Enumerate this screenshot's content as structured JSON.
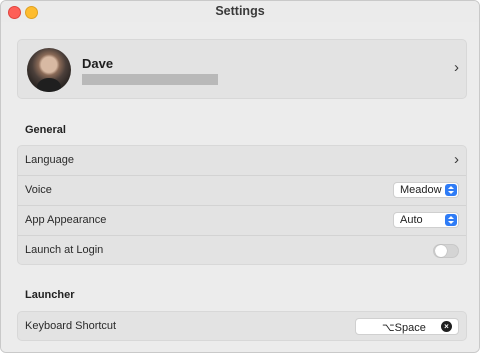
{
  "window": {
    "title": "Settings"
  },
  "profile": {
    "name": "Dave",
    "chevron": "›"
  },
  "sections": {
    "general": {
      "title": "General",
      "language_label": "Language",
      "language_chevron": "›",
      "voice_label": "Voice",
      "voice_value": "Meadow",
      "appearance_label": "App Appearance",
      "appearance_value": "Auto",
      "launch_label": "Launch at Login",
      "launch_enabled": false
    },
    "launcher": {
      "title": "Launcher",
      "shortcut_label": "Keyboard Shortcut",
      "shortcut_value": "⌥Space",
      "clear_symbol": "×"
    }
  },
  "colors": {
    "accent": "#2f7cf6",
    "close": "#fe5f57",
    "minimize": "#febc2e"
  },
  "icons": {
    "close": "close-window-icon",
    "minimize": "minimize-window-icon",
    "chevron": "chevron-right-icon",
    "popup": "up-down-chevron-icon",
    "clear": "clear-x-icon"
  }
}
